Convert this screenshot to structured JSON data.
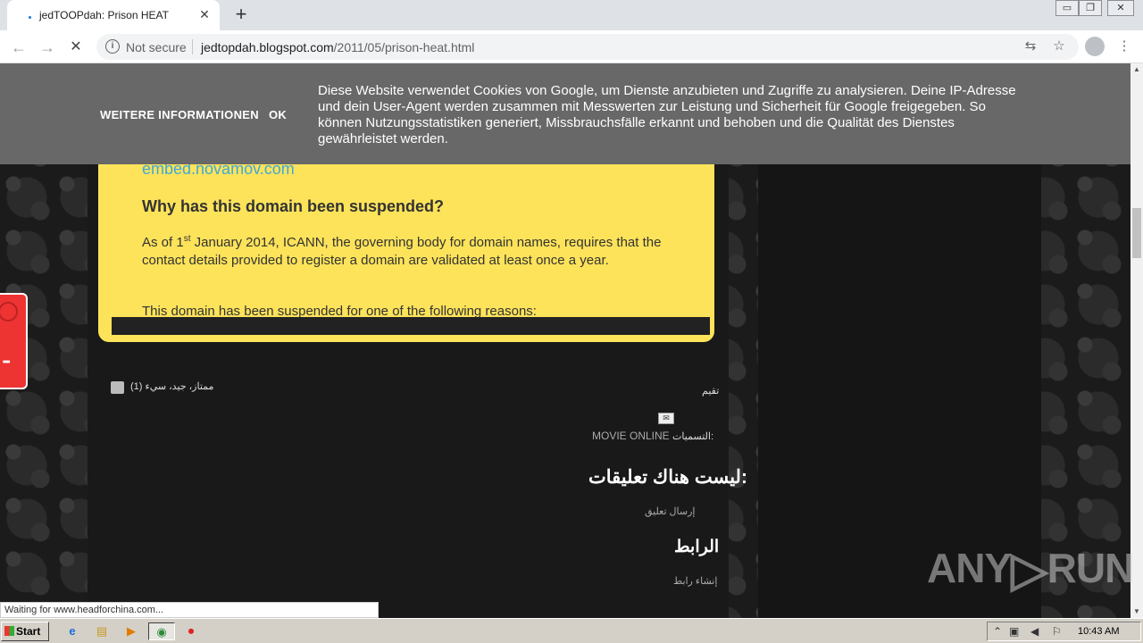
{
  "browser": {
    "tab_title": "jedTOOPdah: Prison HEAT",
    "tab_close": "✕",
    "new_tab": "+",
    "window_controls": [
      "▭",
      "❐",
      "✕"
    ],
    "security_label": "Not secure",
    "url_domain": "jedtopdah.blogspot.com",
    "url_path": "/2011/05/prison-heat.html",
    "nav": {
      "back": "←",
      "forward": "→",
      "reload": "✕"
    },
    "status_text": "Waiting for www.headforchina.com..."
  },
  "cookie_banner": {
    "more_info": "WEITERE INFORMATIONEN",
    "ok": "OK",
    "message": "Diese Website verwendet Cookies von Google, um Dienste anzubieten und Zugriffe zu analysieren. Deine IP-Adresse und dein User-Agent werden zusammen mit Messwerten zur Leistung und Sicherheit für Google freigegeben. So können Nutzungsstatistiken generiert, Missbrauchsfälle erkannt und behoben und die Qualität des Dienstes gewährleistet werden."
  },
  "suspended_box": {
    "domain": "embed.novamov.com",
    "question": "Why has this domain been suspended?",
    "para_pre": "As of 1",
    "para_sup": "st",
    "para_post": " January 2014, ICANN, the governing body for domain names, requires that the contact details provided to register a domain are validated at least once a year.",
    "reasons": "This domain has been suspended for one of the following reasons:"
  },
  "post": {
    "rating_options": "(ممتاز، جيد، سيء (1",
    "rating_label": "تقيم",
    "labels_prefix": "التسميات:",
    "labels_link": "MOVIE ONLINE",
    "comments_heading": "ليست هناك تعليقات:",
    "post_comment": "إرسال تعليق",
    "link_heading": "الرابط",
    "create_link": "إنشاء رابط"
  },
  "watermark": {
    "left": "ANY",
    "play": "▷",
    "right": "RUN"
  },
  "taskbar": {
    "start": "Start",
    "clock": "10:43 AM",
    "apps": [
      "e",
      "▤",
      "▶",
      "◉",
      "⏺"
    ]
  },
  "colors": {
    "accent_yellow": "#fde35a",
    "cookie_bg": "#686868",
    "link_blue": "#3fa8d8"
  }
}
